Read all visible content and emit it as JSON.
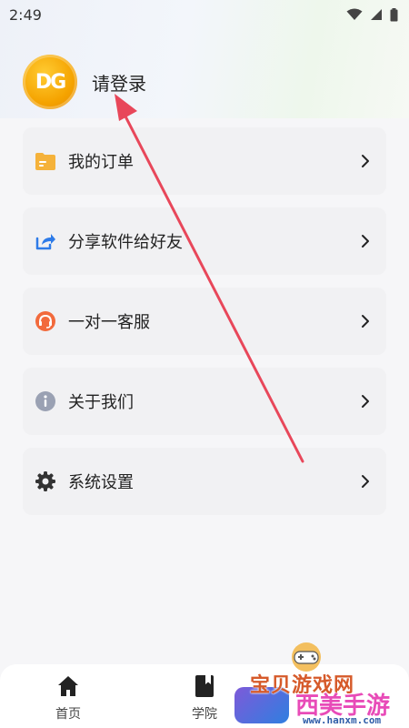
{
  "status_bar": {
    "time": "2:49"
  },
  "profile": {
    "avatar_text": "DG",
    "login_label": "请登录"
  },
  "menu": [
    {
      "label": "我的订单",
      "icon": "folder-icon",
      "color": "#f5b23a"
    },
    {
      "label": "分享软件给好友",
      "icon": "share-icon",
      "color": "#2e7be8"
    },
    {
      "label": "一对一客服",
      "icon": "headset-icon",
      "color": "#f26a3c"
    },
    {
      "label": "关于我们",
      "icon": "info-icon",
      "color": "#9aa1b3"
    },
    {
      "label": "系统设置",
      "icon": "gear-icon",
      "color": "#333333"
    }
  ],
  "bottom_nav": [
    {
      "label": "首页",
      "icon": "home-icon"
    },
    {
      "label": "学院",
      "icon": "book-icon"
    }
  ],
  "watermark": {
    "title": "宝贝游戏网",
    "brand": "西美手游网",
    "url": "www.hanxm.com"
  },
  "colors": {
    "annotation_arrow": "#e8475a",
    "avatar": "#f5a300",
    "background": "#f6f6f8"
  }
}
